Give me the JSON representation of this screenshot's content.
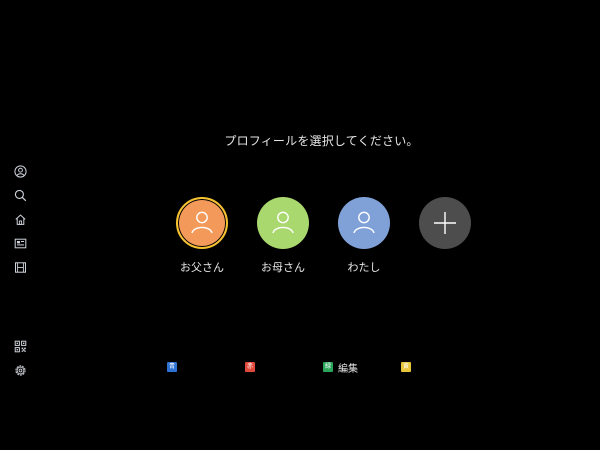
{
  "prompt": "プロフィールを選択してください。",
  "sidebar": {
    "items": [
      {
        "icon": "profile-icon"
      },
      {
        "icon": "search-icon"
      },
      {
        "icon": "home-icon"
      },
      {
        "icon": "tv-icon"
      },
      {
        "icon": "film-icon"
      },
      {
        "icon": "qr-code-icon"
      },
      {
        "icon": "settings-icon"
      }
    ]
  },
  "profiles": [
    {
      "name": "お父さん",
      "color": "#f39a5a",
      "selected": true
    },
    {
      "name": "お母さん",
      "color": "#a9d86e",
      "selected": false
    },
    {
      "name": "わたし",
      "color": "#7fa1d8",
      "selected": false
    }
  ],
  "add_profile": {
    "icon": "plus-icon",
    "color": "#4d4d4d"
  },
  "accent_color": "#f5c230",
  "legend": [
    {
      "key": "blue",
      "color": "#2f72d6",
      "glyph": "青",
      "label": ""
    },
    {
      "key": "red",
      "color": "#e04a3c",
      "glyph": "赤",
      "label": ""
    },
    {
      "key": "green",
      "color": "#2aa55a",
      "glyph": "緑",
      "label": "編集"
    },
    {
      "key": "yellow",
      "color": "#e8c53a",
      "glyph": "黄",
      "label": ""
    }
  ]
}
